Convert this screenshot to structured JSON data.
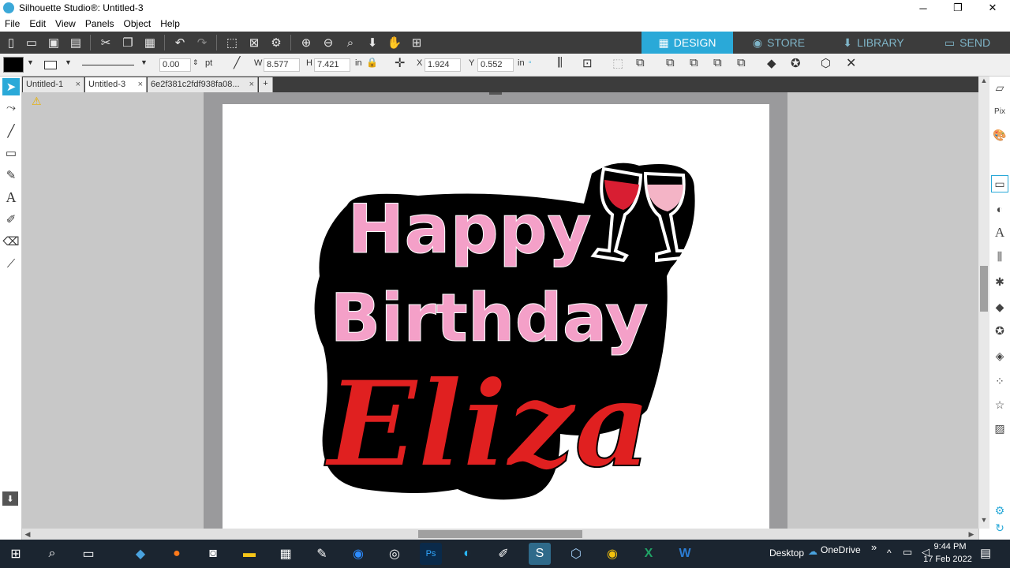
{
  "window": {
    "title": "Silhouette Studio®: Untitled-3",
    "minimize": "─",
    "maximize": "❐",
    "close": "✕"
  },
  "menu": [
    "File",
    "Edit",
    "View",
    "Panels",
    "Object",
    "Help"
  ],
  "nav_tabs": {
    "design": "DESIGN",
    "store": "STORE",
    "library": "LIBRARY",
    "send": "SEND"
  },
  "properties": {
    "line_width": "0.00",
    "line_unit": "pt",
    "w_label": "W",
    "w_value": "8.577",
    "h_label": "H",
    "h_value": "7.421",
    "size_unit": "in",
    "x_label": "X",
    "x_value": "1.924",
    "y_label": "Y",
    "y_value": "0.552",
    "pos_unit": "in"
  },
  "doc_tabs": [
    {
      "label": "Untitled-1",
      "close": "×"
    },
    {
      "label": "Untitled-3",
      "close": "×"
    },
    {
      "label": "6e2f381c2fdf938fa08...",
      "close": "×"
    },
    {
      "label": "+"
    }
  ],
  "design": {
    "line1": "Happy",
    "line2": "Birthday",
    "line3": "Eliza",
    "pink": "#f4a0c8",
    "red": "#e02020",
    "outline": "#000000"
  },
  "taskbar": {
    "desktop_label": "Desktop",
    "onedrive_label": "OneDrive",
    "time": "9:44 PM",
    "date": "17 Feb 2022",
    "chevron": "»",
    "up_arrow": "^"
  },
  "colors": {
    "toolbar_dark": "#3c3c3c",
    "accent": "#2aa9d8",
    "canvas_gray": "#c8c8c8",
    "cut_zone": "#9a9a9c",
    "taskbar": "#1b2530"
  }
}
